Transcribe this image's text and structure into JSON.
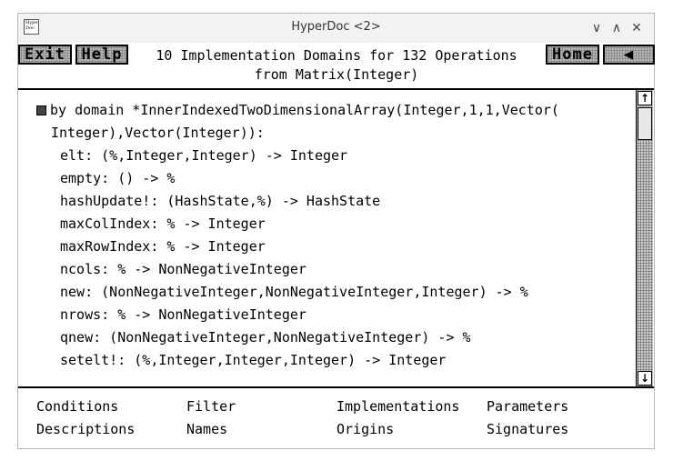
{
  "window": {
    "title": "HyperDoc <2>",
    "icon_text": "Hyper Doc",
    "controls": {
      "minimize": "∨",
      "maximize": "∧",
      "close": "✕"
    }
  },
  "header": {
    "exit_label": "Exit",
    "help_label": "Help",
    "home_label": "Home",
    "back_label": "◀",
    "title_line1": "10 Implementation Domains for 132 Operations",
    "title_line2": "from Matrix(Integer)"
  },
  "content": {
    "domain_line1": "by domain *InnerIndexedTwoDimensionalArray(Integer,1,1,Vector(",
    "domain_line2": "Integer),Vector(Integer)):",
    "operations": [
      "elt: (%,Integer,Integer) -> Integer",
      "empty: () -> %",
      "hashUpdate!: (HashState,%) -> HashState",
      "maxColIndex: % -> Integer",
      "maxRowIndex: % -> Integer",
      "ncols: % -> NonNegativeInteger",
      "new: (NonNegativeInteger,NonNegativeInteger,Integer) -> %",
      "nrows: % -> NonNegativeInteger",
      "qnew: (NonNegativeInteger,NonNegativeInteger) -> %",
      "setelt!: (%,Integer,Integer,Integer) -> Integer"
    ]
  },
  "scrollbar": {
    "up": "↑",
    "down": "↓"
  },
  "footer": {
    "conditions": "Conditions",
    "filter": "Filter",
    "implementations": "Implementations",
    "parameters": "Parameters",
    "descriptions": "Descriptions",
    "names": "Names",
    "origins": "Origins",
    "signatures": "Signatures"
  }
}
